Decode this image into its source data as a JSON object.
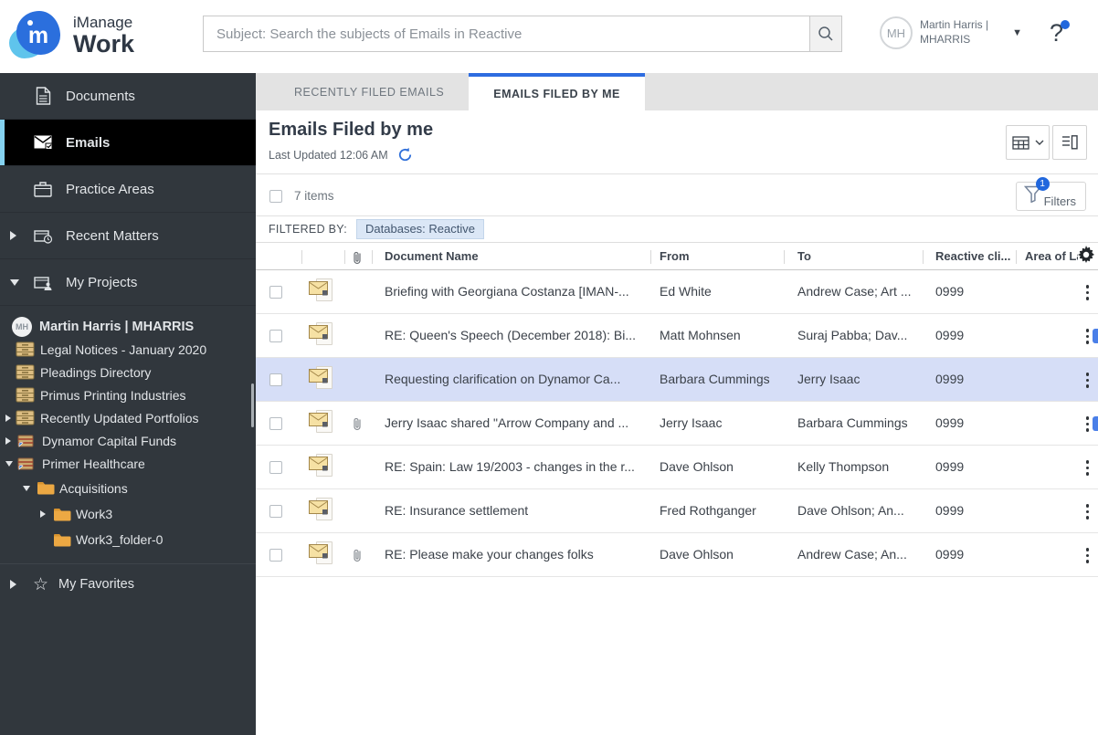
{
  "header": {
    "brand_line1": "iManage",
    "brand_line2": "Work",
    "logo_letter": "m",
    "search_placeholder": "Subject: Search the subjects of Emails in Reactive",
    "user": {
      "initials": "MH",
      "name_line1": "Martin Harris |",
      "name_line2": "MHARRIS"
    },
    "help_glyph": "?"
  },
  "sidebar": {
    "nav": [
      {
        "label": "Documents"
      },
      {
        "label": "Emails"
      },
      {
        "label": "Practice Areas"
      },
      {
        "label": "Recent Matters"
      },
      {
        "label": "My Projects"
      }
    ],
    "tree": [
      {
        "label": "Martin Harris | MHARRIS"
      },
      {
        "label": "Legal Notices - January 2020"
      },
      {
        "label": "Pleadings Directory"
      },
      {
        "label": "Primus Printing Industries"
      },
      {
        "label": "Recently Updated Portfolios"
      },
      {
        "label": "Dynamor Capital Funds"
      },
      {
        "label": "Primer Healthcare"
      },
      {
        "label": "Acquisitions"
      },
      {
        "label": "Work3"
      },
      {
        "label": "Work3_folder-0"
      }
    ],
    "favorites_label": "My Favorites"
  },
  "tabs": [
    {
      "label": "RECENTLY FILED EMAILS",
      "active": false
    },
    {
      "label": "EMAILS FILED BY ME",
      "active": true
    }
  ],
  "page": {
    "title": "Emails Filed by me",
    "last_updated": "Last Updated 12:06 AM"
  },
  "toolbar": {
    "items_count": "7 items",
    "filters_label": "Filters",
    "filters_badge": "1"
  },
  "filter_bar": {
    "label": "FILTERED BY:",
    "chip": "Databases: Reactive"
  },
  "table": {
    "columns": {
      "name": "Document Name",
      "from": "From",
      "to": "To",
      "client": "Reactive cli...",
      "area": "Area of La"
    },
    "rows": [
      {
        "name": "Briefing with Georgiana Costanza [IMAN-...",
        "from": "Ed White",
        "to": "Andrew Case; Art ...",
        "client": "0999",
        "attachment": false,
        "selected": false
      },
      {
        "name": "RE: Queen's Speech (December 2018): Bi...",
        "from": "Matt Mohnsen",
        "to": "Suraj Pabba; Dav...",
        "client": "0999",
        "attachment": false,
        "selected": false
      },
      {
        "name": "Requesting clarification on Dynamor Ca...",
        "from": "Barbara Cummings",
        "to": "Jerry Isaac",
        "client": "0999",
        "attachment": false,
        "selected": true
      },
      {
        "name": "Jerry Isaac shared \"Arrow Company and ...",
        "from": "Jerry Isaac",
        "to": "Barbara Cummings",
        "client": "0999",
        "attachment": true,
        "selected": false
      },
      {
        "name": "RE: Spain: Law 19/2003 - changes in the r...",
        "from": "Dave Ohlson",
        "to": "Kelly Thompson",
        "client": "0999",
        "attachment": false,
        "selected": false
      },
      {
        "name": "RE: Insurance settlement",
        "from": "Fred Rothganger",
        "to": "Dave Ohlson; An...",
        "client": "0999",
        "attachment": false,
        "selected": false
      },
      {
        "name": "RE: Please make your changes folks",
        "from": "Dave Ohlson",
        "to": "Andrew Case; An...",
        "client": "0999",
        "attachment": true,
        "selected": false
      }
    ]
  },
  "colors": {
    "accent_blue": "#2e6ce0",
    "badge_blue": "#2167dd",
    "selected_row": "#d6def7",
    "sidebar_bg": "#31373d",
    "active_nav_bg": "#000000",
    "active_nav_bar": "#85d2f0",
    "chip_bg": "#dbe7f6",
    "folder_orange": "#eca843",
    "drawer_tan": "#dcbd82"
  }
}
